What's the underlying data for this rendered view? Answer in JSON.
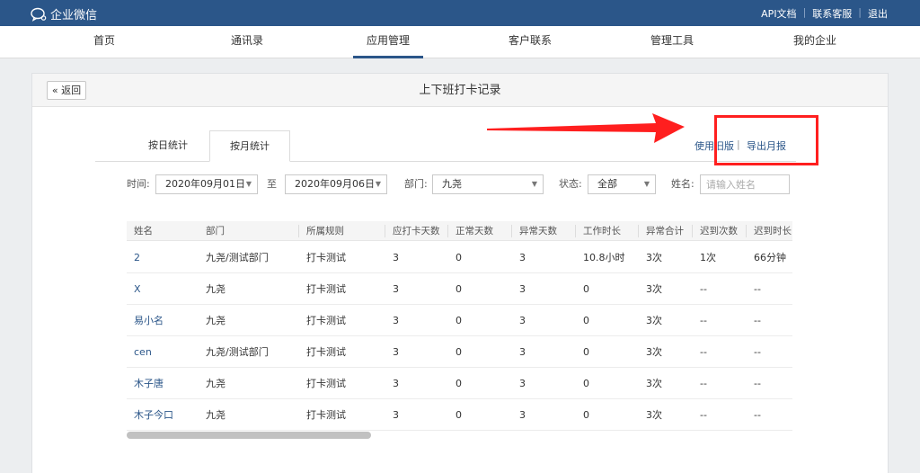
{
  "topbar": {
    "logo_text": "企业微信",
    "links": [
      "API文档",
      "联系客服",
      "退出"
    ],
    "separator": "|"
  },
  "nav": {
    "items": [
      {
        "label": "首页",
        "active": false
      },
      {
        "label": "通讯录",
        "active": false
      },
      {
        "label": "应用管理",
        "active": true
      },
      {
        "label": "客户联系",
        "active": false
      },
      {
        "label": "管理工具",
        "active": false
      },
      {
        "label": "我的企业",
        "active": false
      }
    ]
  },
  "panel": {
    "back_label": "« 返回",
    "title": "上下班打卡记录"
  },
  "tabs": [
    {
      "label": "按日统计",
      "active": false
    },
    {
      "label": "按月统计",
      "active": true
    }
  ],
  "actions": {
    "old_version": "使用旧版",
    "separator": "|",
    "export_month": "导出月报"
  },
  "filters": {
    "time_label": "时间:",
    "start_date": "2020年09月01日",
    "to_label": "至",
    "end_date": "2020年09月06日",
    "dept_label": "部门:",
    "dept_value": "九尧",
    "status_label": "状态:",
    "status_value": "全部",
    "name_label": "姓名:",
    "name_placeholder": "请输入姓名"
  },
  "table": {
    "columns": [
      "姓名",
      "部门",
      "所属规则",
      "应打卡天数",
      "正常天数",
      "异常天数",
      "工作时长",
      "异常合计",
      "迟到次数",
      "迟到时长"
    ],
    "rows": [
      [
        "2",
        "九尧/测试部门",
        "打卡测试",
        "3",
        "0",
        "3",
        "10.8小时",
        "3次",
        "1次",
        "66分钟"
      ],
      [
        "X",
        "九尧",
        "打卡测试",
        "3",
        "0",
        "3",
        "0",
        "3次",
        "--",
        "--"
      ],
      [
        "易小名",
        "九尧",
        "打卡测试",
        "3",
        "0",
        "3",
        "0",
        "3次",
        "--",
        "--"
      ],
      [
        "cen",
        "九尧/测试部门",
        "打卡测试",
        "3",
        "0",
        "3",
        "0",
        "3次",
        "--",
        "--"
      ],
      [
        "木子唐",
        "九尧",
        "打卡测试",
        "3",
        "0",
        "3",
        "0",
        "3次",
        "--",
        "--"
      ],
      [
        "木子今口",
        "九尧",
        "打卡测试",
        "3",
        "0",
        "3",
        "0",
        "3次",
        "--",
        "--"
      ]
    ]
  },
  "colors": {
    "topbar": "#2b5689",
    "link": "#2b5689",
    "annotation": "#ff1f1f"
  }
}
